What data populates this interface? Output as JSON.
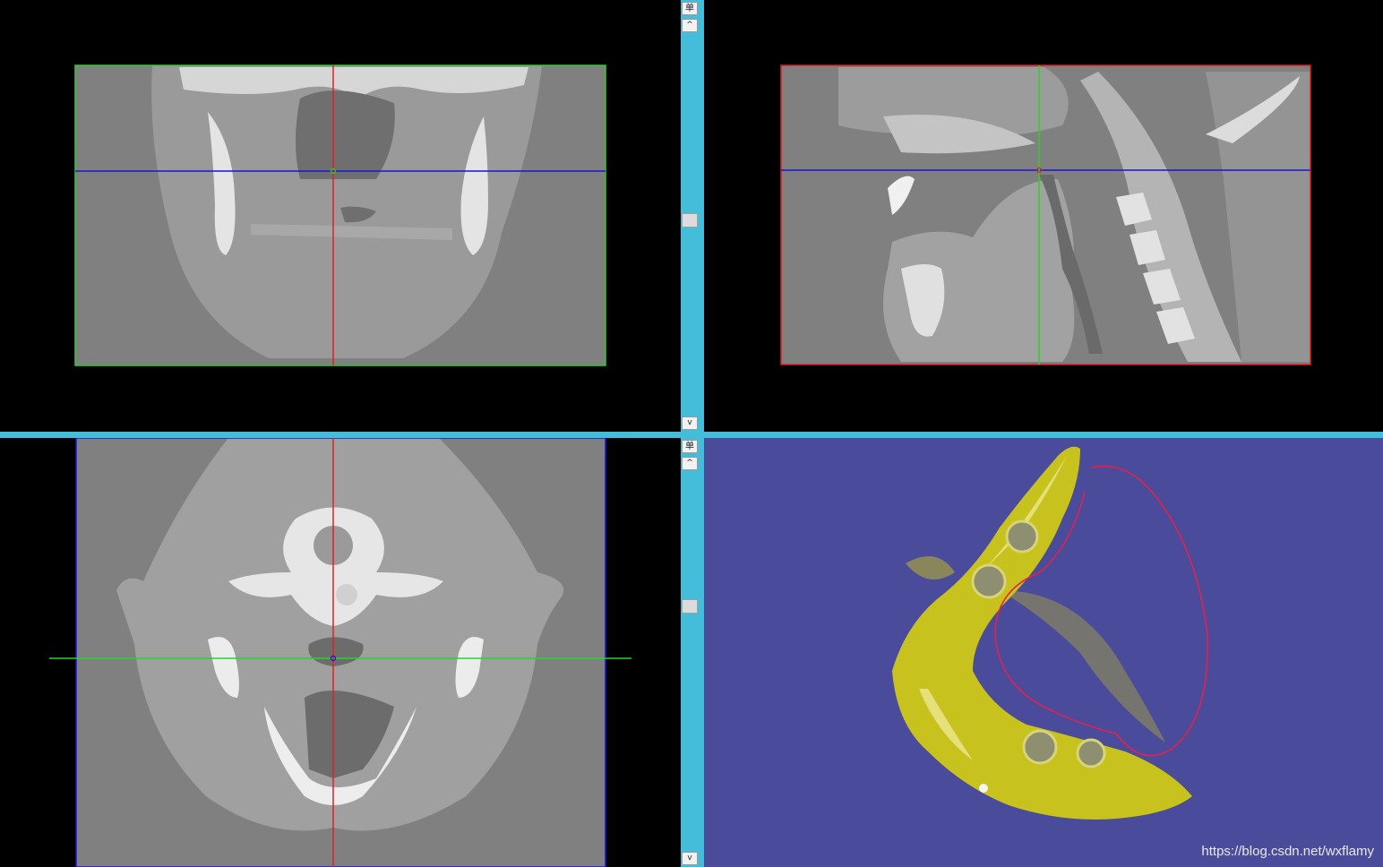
{
  "scrollbars": {
    "top": {
      "mode_label": "单",
      "up_arrow": "^",
      "down_arrow": "v"
    },
    "bottom": {
      "mode_label": "单",
      "up_arrow": "^",
      "down_arrow": "v"
    }
  },
  "views": {
    "coronal": {
      "frame_color": "#2ad12a",
      "h_cursor_color": "#1515e0",
      "v_cursor_color": "#e02020"
    },
    "sagittal": {
      "frame_color": "#e02020",
      "h_cursor_color": "#1515e0",
      "v_cursor_color": "#2ad12a"
    },
    "axial": {
      "frame_color": "#1515e0",
      "h_cursor_color": "#2ad12a",
      "v_cursor_color": "#e02020"
    },
    "render3d": {
      "background": "#4b4b9b",
      "model_color": "#c8c21e",
      "curve_color": "#e8204a"
    }
  },
  "watermark": "https://blog.csdn.net/wxflamy"
}
